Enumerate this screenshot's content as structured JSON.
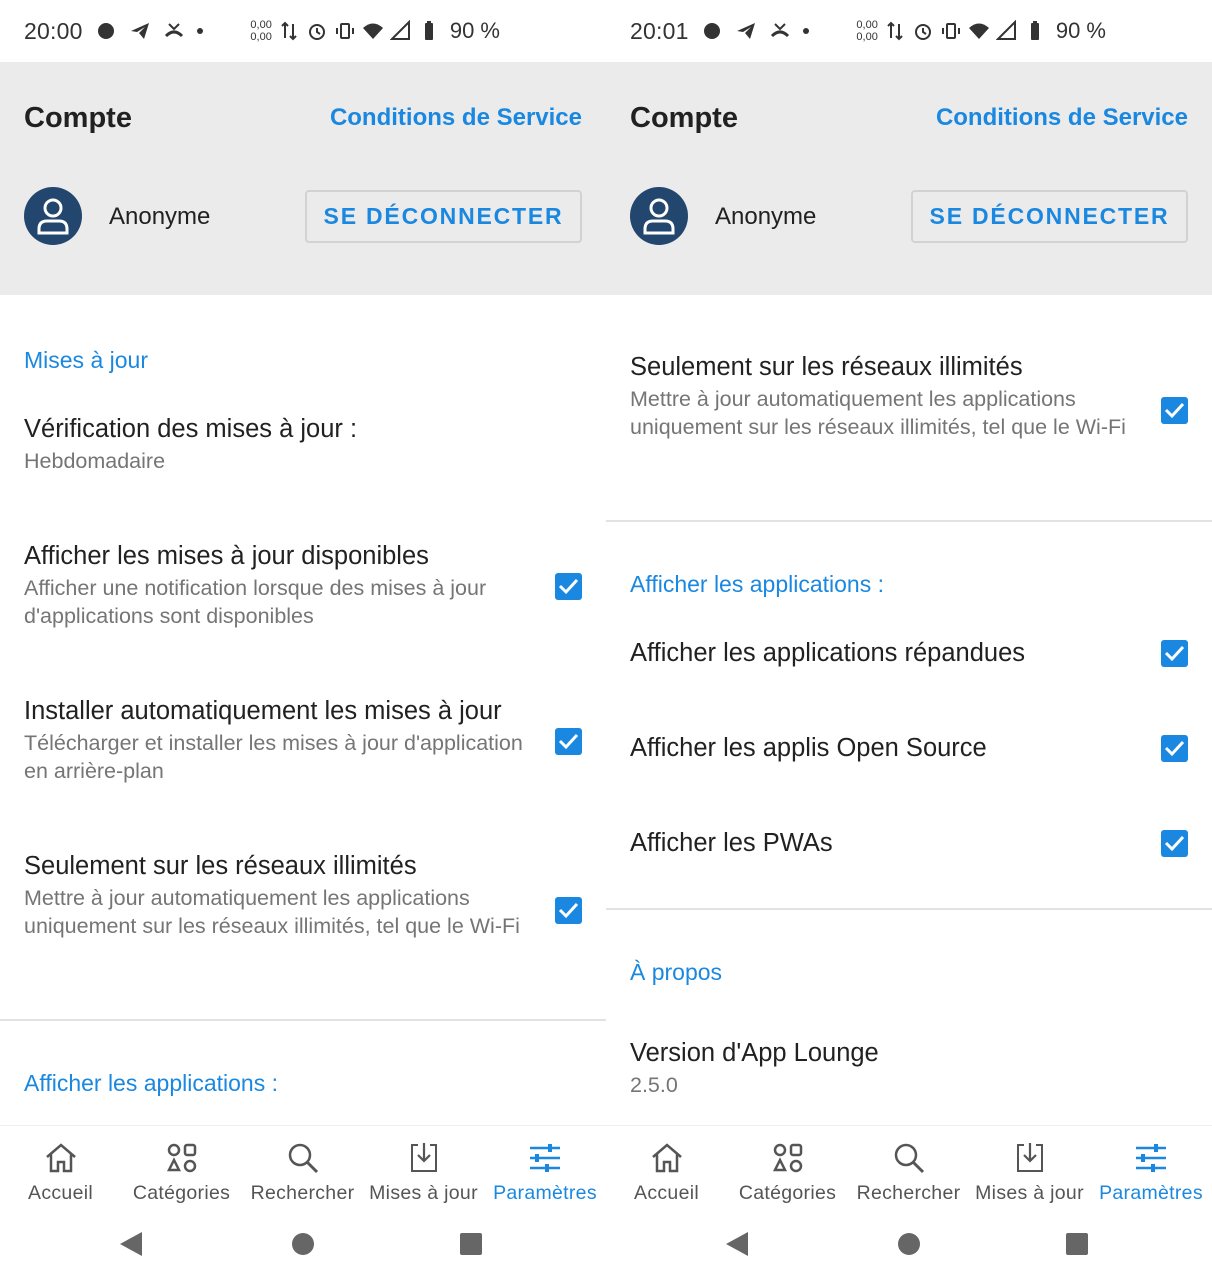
{
  "colors": {
    "accent": "#1a88e0",
    "header_bg": "#ebebeb",
    "avatar_bg": "#22466e"
  },
  "left": {
    "status": {
      "time": "20:00",
      "speed_up": "0,00",
      "speed_down": "0,00",
      "battery": "90 %"
    },
    "account": {
      "title": "Compte",
      "tos_link": "Conditions de Service",
      "user_name": "Anonyme",
      "logout_label": "SE DÉCONNECTER"
    },
    "sections": {
      "updates": {
        "title": "Mises à jour"
      },
      "show_apps": {
        "title": "Afficher les applications :"
      }
    },
    "prefs": {
      "check_updates": {
        "title": "Vérification des mises à jour :",
        "summary": "Hebdomadaire"
      },
      "show_updates": {
        "title": "Afficher les mises à jour disponibles",
        "summary": "Afficher une notification lorsque des mises à jour d'applications sont disponibles",
        "checked": true
      },
      "auto_install": {
        "title": "Installer automatiquement les mises à jour",
        "summary": "Télécharger et installer les mises à jour d'application en arrière-plan",
        "checked": true
      },
      "unmetered": {
        "title": "Seulement sur les réseaux illimités",
        "summary": "Mettre à jour automatiquement les applications uniquement sur les réseaux illimités, tel que le Wi-Fi",
        "checked": true
      }
    }
  },
  "right": {
    "status": {
      "time": "20:01",
      "speed_up": "0,00",
      "speed_down": "0,00",
      "battery": "90 %"
    },
    "account": {
      "title": "Compte",
      "tos_link": "Conditions de Service",
      "user_name": "Anonyme",
      "logout_label": "SE DÉCONNECTER"
    },
    "sections": {
      "show_apps": {
        "title": "Afficher les applications :"
      },
      "about": {
        "title": "À propos"
      }
    },
    "prefs": {
      "unmetered": {
        "title": "Seulement sur les réseaux illimités",
        "summary": "Mettre à jour automatiquement les applications uniquement sur les réseaux illimités, tel que le Wi-Fi",
        "checked": true
      },
      "common_apps": {
        "title": "Afficher les applications répandues",
        "checked": true
      },
      "open_source": {
        "title": "Afficher les applis Open Source",
        "checked": true
      },
      "pwas": {
        "title": "Afficher les PWAs",
        "checked": true
      },
      "version": {
        "title": "Version d'App Lounge",
        "summary": "2.5.0"
      }
    }
  },
  "bottom_nav": {
    "items": [
      {
        "label": "Accueil",
        "icon": "home-icon"
      },
      {
        "label": "Catégories",
        "icon": "categories-icon"
      },
      {
        "label": "Rechercher",
        "icon": "search-icon"
      },
      {
        "label": "Mises à jour",
        "icon": "download-icon"
      },
      {
        "label": "Paramètres",
        "icon": "settings-sliders-icon",
        "active": true
      }
    ]
  }
}
